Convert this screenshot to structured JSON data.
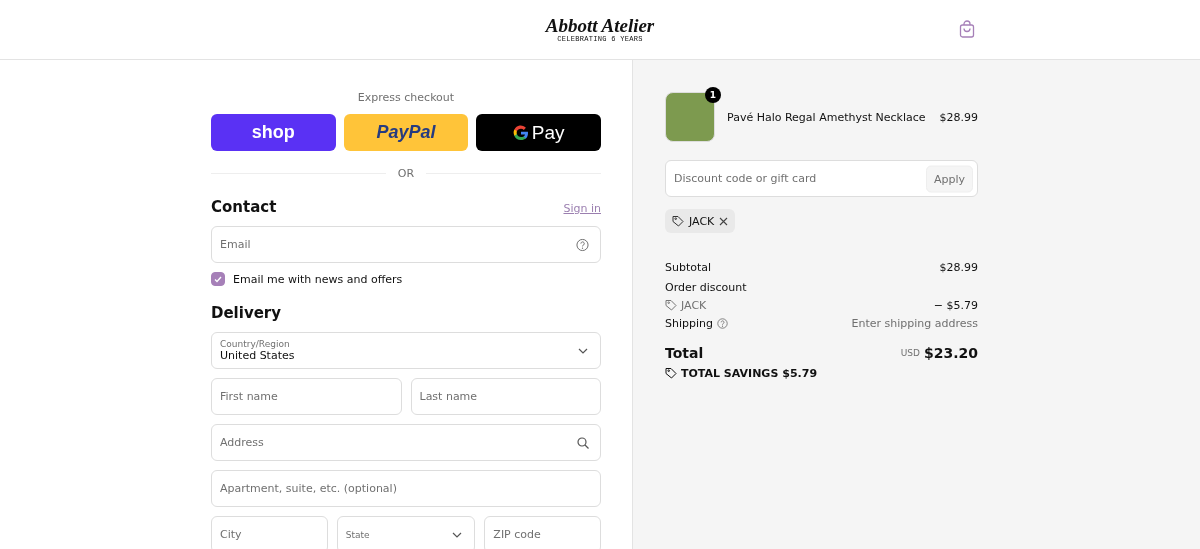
{
  "header": {
    "logo_title": "Abbott Atelier",
    "logo_subtitle": "CELEBRATING 6 YEARS"
  },
  "express_checkout": {
    "title": "Express checkout",
    "buttons": [
      {
        "kind": "shop",
        "label": "shop"
      },
      {
        "kind": "paypal",
        "label": "PayPal"
      },
      {
        "kind": "gpay",
        "label": "Pay"
      }
    ],
    "divider_label": "OR"
  },
  "contact": {
    "heading": "Contact",
    "sign_in": "Sign in",
    "email": {
      "placeholder": "Email"
    },
    "newsletter": {
      "label": "Email me with news and offers",
      "checked": true
    }
  },
  "delivery": {
    "heading": "Delivery",
    "rows": [
      [
        {
          "kind": "select",
          "label": "Country/Region",
          "value": "United States"
        }
      ],
      [
        {
          "kind": "text",
          "placeholder": "First name"
        },
        {
          "kind": "text",
          "placeholder": "Last name"
        }
      ],
      [
        {
          "kind": "search",
          "placeholder": "Address"
        }
      ],
      [
        {
          "kind": "text",
          "placeholder": "Apartment, suite, etc. (optional)"
        }
      ],
      [
        {
          "kind": "text",
          "placeholder": "City"
        },
        {
          "kind": "select",
          "label": "State"
        },
        {
          "kind": "text",
          "placeholder": "ZIP code"
        }
      ]
    ]
  },
  "summary": {
    "item": {
      "name": "Pavé Halo Regal Amethyst Necklace",
      "price": "$28.99",
      "quantity": "1"
    },
    "discount": {
      "placeholder": "Discount code or gift card",
      "button": "Apply"
    },
    "applied_codes": [
      {
        "code": "JACK"
      }
    ],
    "subtotal": {
      "label": "Subtotal",
      "value": "$28.99"
    },
    "order_discount": {
      "label": "Order discount",
      "code": "JACK",
      "value": "− $5.79"
    },
    "shipping": {
      "label": "Shipping",
      "value": "Enter shipping address"
    },
    "total": {
      "label": "Total",
      "currency": "USD",
      "value": "$23.20"
    },
    "savings": {
      "label": "TOTAL SAVINGS",
      "value": "$5.79"
    }
  }
}
